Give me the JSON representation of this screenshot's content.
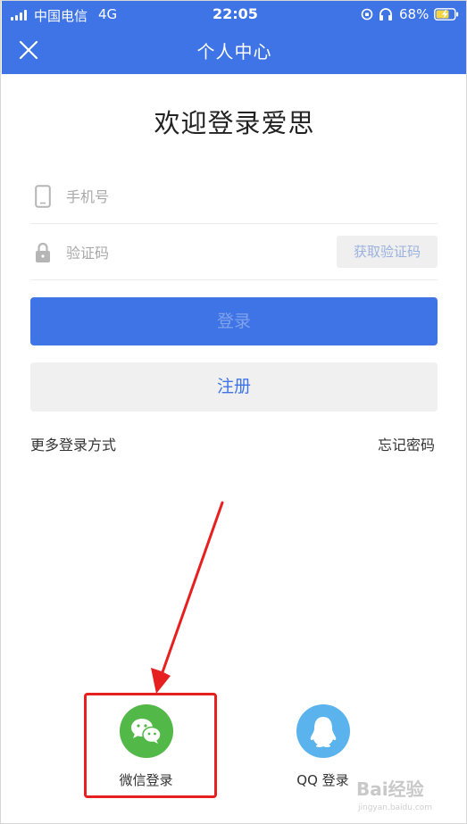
{
  "status_bar": {
    "carrier": "中国电信",
    "network": "4G",
    "time": "22:05",
    "battery": "68%"
  },
  "nav": {
    "title": "个人中心",
    "close_icon": "close-icon"
  },
  "welcome_title": "欢迎登录爱思",
  "form": {
    "phone_placeholder": "手机号",
    "code_placeholder": "验证码",
    "get_code_label": "获取验证码",
    "login_label": "登录",
    "register_label": "注册"
  },
  "links": {
    "more_login": "更多登录方式",
    "forgot_password": "忘记密码"
  },
  "social_login": {
    "wechat_label": "微信登录",
    "qq_label": "QQ 登录"
  },
  "colors": {
    "brand_blue": "#3f74e6",
    "wechat_green": "#52b848",
    "qq_blue": "#5bb3ee",
    "annotation_red": "#e5201f"
  },
  "watermark": {
    "text": "Bai经验",
    "sub": "jingyan.baidu.com"
  }
}
